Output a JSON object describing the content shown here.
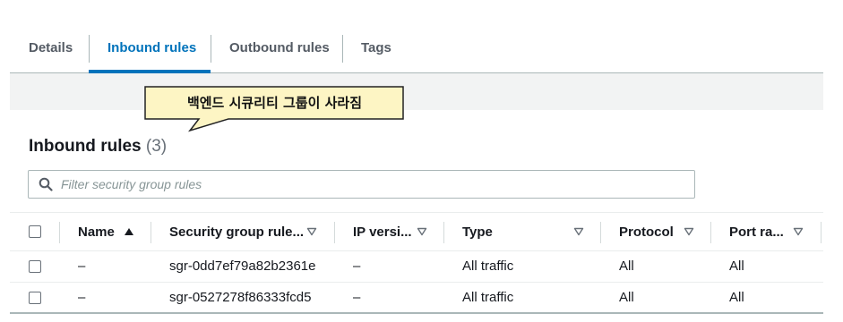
{
  "tabs": [
    {
      "label": "Details",
      "active": false
    },
    {
      "label": "Inbound rules",
      "active": true
    },
    {
      "label": "Outbound rules",
      "active": false
    },
    {
      "label": "Tags",
      "active": false
    }
  ],
  "callout": {
    "text": "백엔드 시큐리티 그룹이 사라짐",
    "fill": "#fdf5c4",
    "stroke": "#222222"
  },
  "section": {
    "title": "Inbound rules",
    "count": "(3)"
  },
  "search": {
    "placeholder": "Filter security group rules",
    "value": ""
  },
  "table": {
    "columns": [
      {
        "label": "Name",
        "sort": "ascending"
      },
      {
        "label": "Security group rule...",
        "sort": "sortable"
      },
      {
        "label": "IP versi...",
        "sort": "sortable"
      },
      {
        "label": "Type",
        "sort": "sortable"
      },
      {
        "label": "Protocol",
        "sort": "sortable"
      },
      {
        "label": "Port ra...",
        "sort": "sortable"
      }
    ],
    "rows": [
      {
        "name": "–",
        "rule_id": "sgr-0dd7ef79a82b2361e",
        "ip_version": "–",
        "type": "All traffic",
        "protocol": "All",
        "port_range": "All"
      },
      {
        "name": "–",
        "rule_id": "sgr-0527278f86333fcd5",
        "ip_version": "–",
        "type": "All traffic",
        "protocol": "All",
        "port_range": "All"
      }
    ]
  },
  "colors": {
    "accent": "#0073bb",
    "text": "#16191f",
    "muted": "#687078",
    "border": "#aab7b8"
  }
}
